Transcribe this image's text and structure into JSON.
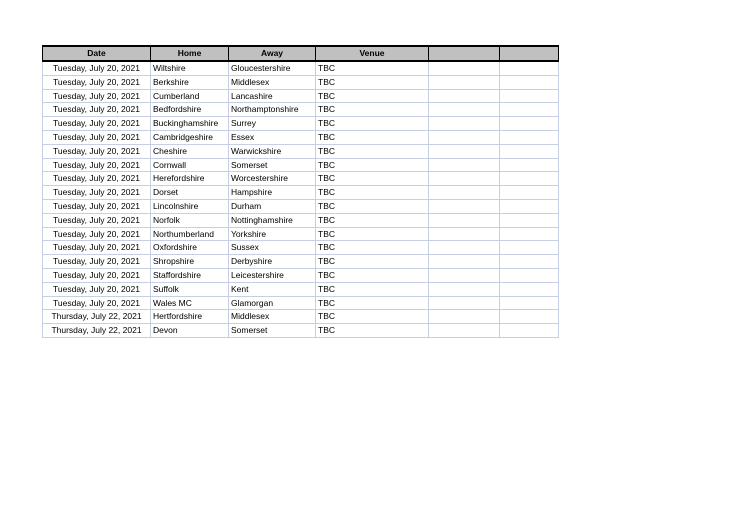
{
  "table": {
    "name": "fixtures-table",
    "header_fill": "#c0c0c0",
    "grid_color": "#c6cfe3",
    "columns": [
      {
        "key": "date",
        "label": "Date"
      },
      {
        "key": "home",
        "label": "Home"
      },
      {
        "key": "away",
        "label": "Away"
      },
      {
        "key": "venue",
        "label": "Venue"
      },
      {
        "key": "extra1",
        "label": ""
      },
      {
        "key": "extra2",
        "label": ""
      }
    ],
    "rows": [
      {
        "date": "Tuesday, July 20, 2021",
        "home": "Wiltshire",
        "away": "Gloucestershire",
        "venue": "TBC",
        "extra1": "",
        "extra2": ""
      },
      {
        "date": "Tuesday, July 20, 2021",
        "home": "Berkshire",
        "away": "Middlesex",
        "venue": "TBC",
        "extra1": "",
        "extra2": ""
      },
      {
        "date": "Tuesday, July 20, 2021",
        "home": "Cumberland",
        "away": "Lancashire",
        "venue": "TBC",
        "extra1": "",
        "extra2": ""
      },
      {
        "date": "Tuesday, July 20, 2021",
        "home": "Bedfordshire",
        "away": "Northamptonshire",
        "venue": "TBC",
        "extra1": "",
        "extra2": ""
      },
      {
        "date": "Tuesday, July 20, 2021",
        "home": "Buckinghamshire",
        "away": "Surrey",
        "venue": "TBC",
        "extra1": "",
        "extra2": ""
      },
      {
        "date": "Tuesday, July 20, 2021",
        "home": "Cambridgeshire",
        "away": "Essex",
        "venue": "TBC",
        "extra1": "",
        "extra2": ""
      },
      {
        "date": "Tuesday, July 20, 2021",
        "home": "Cheshire",
        "away": "Warwickshire",
        "venue": "TBC",
        "extra1": "",
        "extra2": ""
      },
      {
        "date": "Tuesday, July 20, 2021",
        "home": "Cornwall",
        "away": "Somerset",
        "venue": "TBC",
        "extra1": "",
        "extra2": ""
      },
      {
        "date": "Tuesday, July 20, 2021",
        "home": "Herefordshire",
        "away": "Worcestershire",
        "venue": "TBC",
        "extra1": "",
        "extra2": ""
      },
      {
        "date": "Tuesday, July 20, 2021",
        "home": "Dorset",
        "away": "Hampshire",
        "venue": "TBC",
        "extra1": "",
        "extra2": ""
      },
      {
        "date": "Tuesday, July 20, 2021",
        "home": "Lincolnshire",
        "away": "Durham",
        "venue": "TBC",
        "extra1": "",
        "extra2": ""
      },
      {
        "date": "Tuesday, July 20, 2021",
        "home": "Norfolk",
        "away": "Nottinghamshire",
        "venue": "TBC",
        "extra1": "",
        "extra2": ""
      },
      {
        "date": "Tuesday, July 20, 2021",
        "home": "Northumberland",
        "away": "Yorkshire",
        "venue": "TBC",
        "extra1": "",
        "extra2": ""
      },
      {
        "date": "Tuesday, July 20, 2021",
        "home": "Oxfordshire",
        "away": "Sussex",
        "venue": "TBC",
        "extra1": "",
        "extra2": ""
      },
      {
        "date": "Tuesday, July 20, 2021",
        "home": "Shropshire",
        "away": "Derbyshire",
        "venue": "TBC",
        "extra1": "",
        "extra2": ""
      },
      {
        "date": "Tuesday, July 20, 2021",
        "home": "Staffordshire",
        "away": "Leicestershire",
        "venue": "TBC",
        "extra1": "",
        "extra2": ""
      },
      {
        "date": "Tuesday, July 20, 2021",
        "home": "Suffolk",
        "away": "Kent",
        "venue": "TBC",
        "extra1": "",
        "extra2": ""
      },
      {
        "date": "Tuesday, July 20, 2021",
        "home": "Wales MC",
        "away": "Glamorgan",
        "venue": "TBC",
        "extra1": "",
        "extra2": ""
      },
      {
        "date": "Thursday, July 22, 2021",
        "home": "Hertfordshire",
        "away": "Middlesex",
        "venue": "TBC",
        "extra1": "",
        "extra2": ""
      },
      {
        "date": "Thursday, July 22, 2021",
        "home": "Devon",
        "away": "Somerset",
        "venue": "TBC",
        "extra1": "",
        "extra2": ""
      }
    ]
  }
}
